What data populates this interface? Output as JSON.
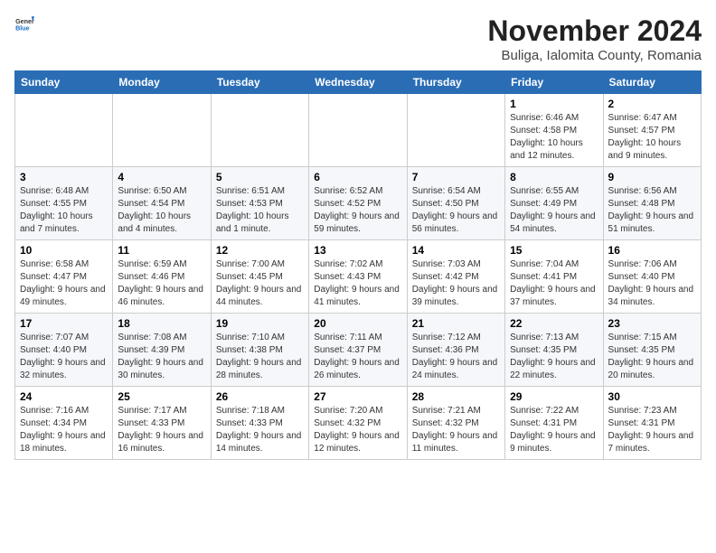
{
  "logo": {
    "text_general": "General",
    "text_blue": "Blue"
  },
  "title": "November 2024",
  "subtitle": "Buliga, Ialomita County, Romania",
  "weekdays": [
    "Sunday",
    "Monday",
    "Tuesday",
    "Wednesday",
    "Thursday",
    "Friday",
    "Saturday"
  ],
  "weeks": [
    [
      {
        "num": "",
        "info": ""
      },
      {
        "num": "",
        "info": ""
      },
      {
        "num": "",
        "info": ""
      },
      {
        "num": "",
        "info": ""
      },
      {
        "num": "",
        "info": ""
      },
      {
        "num": "1",
        "info": "Sunrise: 6:46 AM\nSunset: 4:58 PM\nDaylight: 10 hours and 12 minutes."
      },
      {
        "num": "2",
        "info": "Sunrise: 6:47 AM\nSunset: 4:57 PM\nDaylight: 10 hours and 9 minutes."
      }
    ],
    [
      {
        "num": "3",
        "info": "Sunrise: 6:48 AM\nSunset: 4:55 PM\nDaylight: 10 hours and 7 minutes."
      },
      {
        "num": "4",
        "info": "Sunrise: 6:50 AM\nSunset: 4:54 PM\nDaylight: 10 hours and 4 minutes."
      },
      {
        "num": "5",
        "info": "Sunrise: 6:51 AM\nSunset: 4:53 PM\nDaylight: 10 hours and 1 minute."
      },
      {
        "num": "6",
        "info": "Sunrise: 6:52 AM\nSunset: 4:52 PM\nDaylight: 9 hours and 59 minutes."
      },
      {
        "num": "7",
        "info": "Sunrise: 6:54 AM\nSunset: 4:50 PM\nDaylight: 9 hours and 56 minutes."
      },
      {
        "num": "8",
        "info": "Sunrise: 6:55 AM\nSunset: 4:49 PM\nDaylight: 9 hours and 54 minutes."
      },
      {
        "num": "9",
        "info": "Sunrise: 6:56 AM\nSunset: 4:48 PM\nDaylight: 9 hours and 51 minutes."
      }
    ],
    [
      {
        "num": "10",
        "info": "Sunrise: 6:58 AM\nSunset: 4:47 PM\nDaylight: 9 hours and 49 minutes."
      },
      {
        "num": "11",
        "info": "Sunrise: 6:59 AM\nSunset: 4:46 PM\nDaylight: 9 hours and 46 minutes."
      },
      {
        "num": "12",
        "info": "Sunrise: 7:00 AM\nSunset: 4:45 PM\nDaylight: 9 hours and 44 minutes."
      },
      {
        "num": "13",
        "info": "Sunrise: 7:02 AM\nSunset: 4:43 PM\nDaylight: 9 hours and 41 minutes."
      },
      {
        "num": "14",
        "info": "Sunrise: 7:03 AM\nSunset: 4:42 PM\nDaylight: 9 hours and 39 minutes."
      },
      {
        "num": "15",
        "info": "Sunrise: 7:04 AM\nSunset: 4:41 PM\nDaylight: 9 hours and 37 minutes."
      },
      {
        "num": "16",
        "info": "Sunrise: 7:06 AM\nSunset: 4:40 PM\nDaylight: 9 hours and 34 minutes."
      }
    ],
    [
      {
        "num": "17",
        "info": "Sunrise: 7:07 AM\nSunset: 4:40 PM\nDaylight: 9 hours and 32 minutes."
      },
      {
        "num": "18",
        "info": "Sunrise: 7:08 AM\nSunset: 4:39 PM\nDaylight: 9 hours and 30 minutes."
      },
      {
        "num": "19",
        "info": "Sunrise: 7:10 AM\nSunset: 4:38 PM\nDaylight: 9 hours and 28 minutes."
      },
      {
        "num": "20",
        "info": "Sunrise: 7:11 AM\nSunset: 4:37 PM\nDaylight: 9 hours and 26 minutes."
      },
      {
        "num": "21",
        "info": "Sunrise: 7:12 AM\nSunset: 4:36 PM\nDaylight: 9 hours and 24 minutes."
      },
      {
        "num": "22",
        "info": "Sunrise: 7:13 AM\nSunset: 4:35 PM\nDaylight: 9 hours and 22 minutes."
      },
      {
        "num": "23",
        "info": "Sunrise: 7:15 AM\nSunset: 4:35 PM\nDaylight: 9 hours and 20 minutes."
      }
    ],
    [
      {
        "num": "24",
        "info": "Sunrise: 7:16 AM\nSunset: 4:34 PM\nDaylight: 9 hours and 18 minutes."
      },
      {
        "num": "25",
        "info": "Sunrise: 7:17 AM\nSunset: 4:33 PM\nDaylight: 9 hours and 16 minutes."
      },
      {
        "num": "26",
        "info": "Sunrise: 7:18 AM\nSunset: 4:33 PM\nDaylight: 9 hours and 14 minutes."
      },
      {
        "num": "27",
        "info": "Sunrise: 7:20 AM\nSunset: 4:32 PM\nDaylight: 9 hours and 12 minutes."
      },
      {
        "num": "28",
        "info": "Sunrise: 7:21 AM\nSunset: 4:32 PM\nDaylight: 9 hours and 11 minutes."
      },
      {
        "num": "29",
        "info": "Sunrise: 7:22 AM\nSunset: 4:31 PM\nDaylight: 9 hours and 9 minutes."
      },
      {
        "num": "30",
        "info": "Sunrise: 7:23 AM\nSunset: 4:31 PM\nDaylight: 9 hours and 7 minutes."
      }
    ]
  ]
}
